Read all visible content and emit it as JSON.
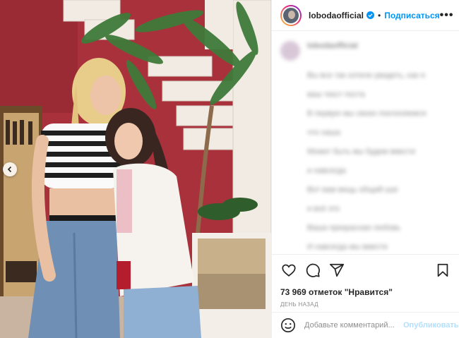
{
  "post": {
    "username": "lobodaofficial",
    "separator": "•",
    "follow_label": "Подписаться",
    "more_label": "•••"
  },
  "comments_blurred": {
    "author": "lobodaofficial",
    "lines": [
      "Вы все так хотели увидеть, как я",
      "ваш текст поста",
      "В первую мы своих поклоняемся",
      "что наша",
      "Может быть мы будем вместе",
      "и навсегда",
      "Вот вам вещь общий шаг",
      "и всё это",
      "Ваша прекрасная любовь",
      "И навсегда мы вместе"
    ]
  },
  "actions": {
    "likes_text": "73 969 отметок \"Нравится\"",
    "time_text": "ДЕНЬ НАЗАД"
  },
  "comment_box": {
    "placeholder": "Добавьте комментарий...",
    "publish_label": "Опубликовать"
  },
  "icons": [
    "chevron-left-icon",
    "verified-badge-icon",
    "heart-icon",
    "comment-icon",
    "share-icon",
    "bookmark-icon",
    "emoji-icon"
  ],
  "colors": {
    "accent": "#0095f6",
    "wall": "#a8343c",
    "text": "#262626",
    "muted": "#8e8e8e"
  }
}
